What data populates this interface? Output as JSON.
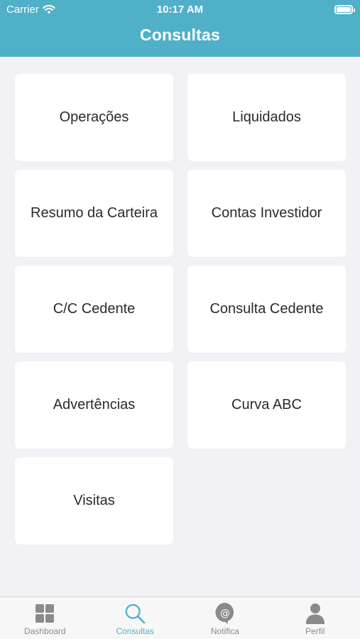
{
  "status_bar": {
    "carrier": "Carrier",
    "time": "10:17 AM"
  },
  "header": {
    "title": "Consultas"
  },
  "tiles": [
    {
      "label": "Operações"
    },
    {
      "label": "Liquidados"
    },
    {
      "label": "Resumo da Carteira"
    },
    {
      "label": "Contas Investidor"
    },
    {
      "label": "C/C Cedente"
    },
    {
      "label": "Consulta Cedente"
    },
    {
      "label": "Advertências"
    },
    {
      "label": "Curva ABC"
    },
    {
      "label": "Visitas"
    }
  ],
  "tabbar": {
    "active": "Consultas",
    "tabs": [
      {
        "label": "Dashboard",
        "icon": "dashboard-icon"
      },
      {
        "label": "Consultas",
        "icon": "search-icon"
      },
      {
        "label": "Notifica",
        "icon": "notification-icon"
      },
      {
        "label": "Perfil",
        "icon": "profile-icon"
      }
    ]
  },
  "colors": {
    "accent": "#4fb0c8",
    "background": "#f2f2f6",
    "tile": "#ffffff",
    "tab_inactive": "#8a8a8a"
  }
}
